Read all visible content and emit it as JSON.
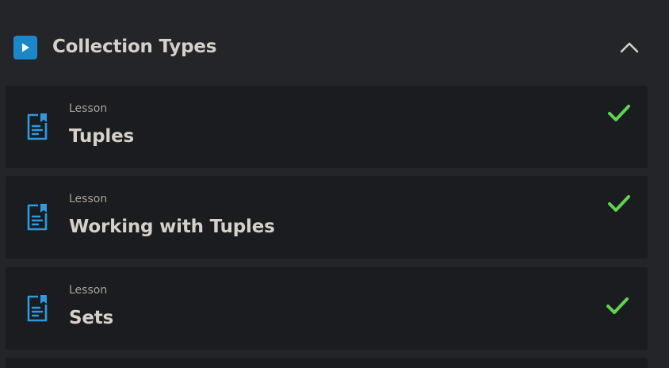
{
  "section": {
    "title": "Collection Types",
    "badge_icon": "play-icon",
    "collapse_icon": "chevron-up-icon"
  },
  "lessons": [
    {
      "type": "Lesson",
      "title": "Tuples",
      "icon": "document-icon",
      "status_icon": "checkmark-icon"
    },
    {
      "type": "Lesson",
      "title": "Working with Tuples",
      "icon": "document-icon",
      "status_icon": "checkmark-icon"
    },
    {
      "type": "Lesson",
      "title": "Sets",
      "icon": "document-icon",
      "status_icon": "checkmark-icon"
    }
  ],
  "colors": {
    "background": "#242528",
    "card": "#1b1c1f",
    "accent_blue": "#1b87c8",
    "icon_blue": "#2a9be0",
    "check_green": "#5ed44f",
    "text_primary": "#d6d1c8",
    "text_secondary": "#a8a39a"
  }
}
